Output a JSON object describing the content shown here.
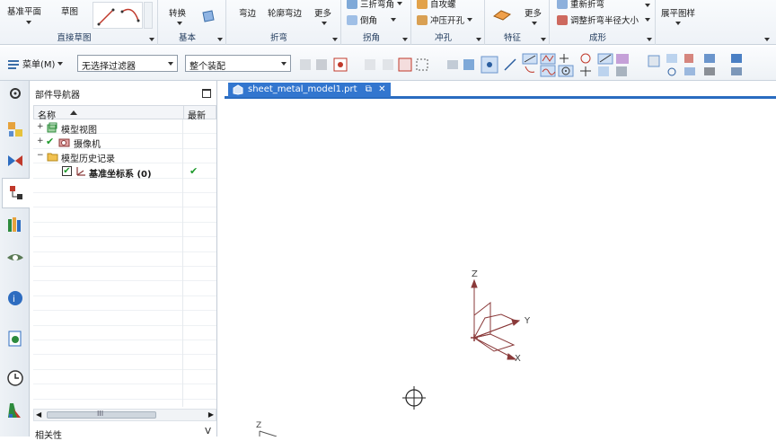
{
  "ribbon": {
    "buttons": {
      "datum_plane": "基准平面",
      "sketch": "草图",
      "convert": "转换",
      "bend": "弯边",
      "contour_flange": "轮廓弯边",
      "more_bend": "更多",
      "three_bend_corner": "三折弯角",
      "chamfer": "倒角",
      "self_drill": "自攻螺",
      "punch_hole": "冲压开孔",
      "more_feature": "更多",
      "rebend": "重新折弯",
      "adjust_bend_radius": "调整折弯半径大小",
      "unfold_pattern": "展平图样"
    },
    "groups": {
      "direct_sketch": "直接草图",
      "base": "基本",
      "bend": "折弯",
      "corner": "拐角",
      "punch": "冲孔",
      "feature": "特征",
      "form": "成形"
    }
  },
  "toolbar": {
    "menu_label": "菜单(M)",
    "filter_value": "无选择过滤器",
    "assembly_value": "整个装配"
  },
  "navigator": {
    "title": "部件导航器",
    "col_name": "名称",
    "col_latest": "最新",
    "items": [
      {
        "label": "模型视图",
        "expander": "+"
      },
      {
        "label": "摄像机",
        "expander": "+"
      },
      {
        "label": "模型历史记录",
        "expander": "−"
      },
      {
        "label": "基准坐标系 (0)",
        "latest": "✔"
      }
    ],
    "scroll_marker": "III",
    "sub_panel_title": "相关性",
    "sub_panel_toggle": "V"
  },
  "graphics": {
    "tab_title": "sheet_metal_model1.prt",
    "tab_close": "✕",
    "axis_x": "X",
    "axis_y": "Y",
    "axis_z": "Z",
    "mini_axis_z": "Z"
  },
  "colors": {
    "tab_blue": "#3276cf",
    "datum_csys": "#8a3a3a",
    "check_green": "#1e9a2c"
  }
}
